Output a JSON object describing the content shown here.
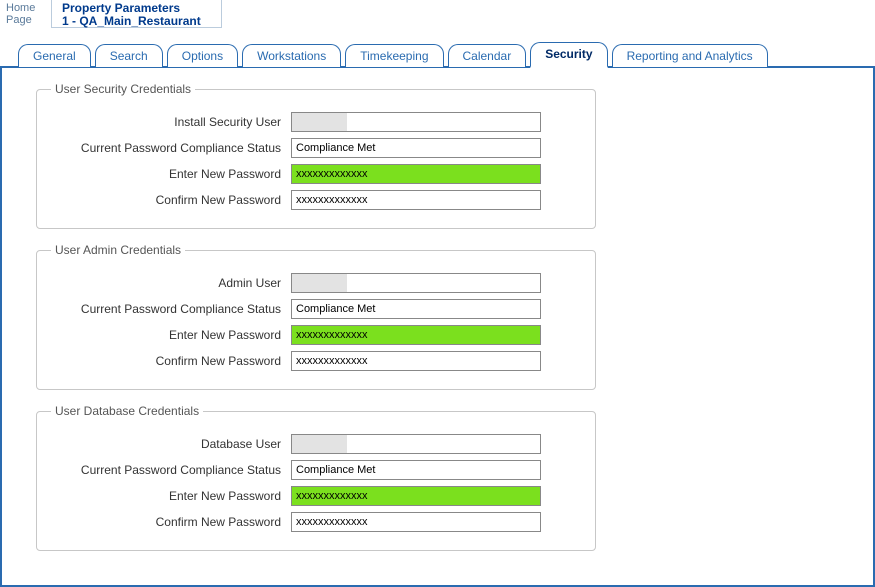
{
  "header": {
    "home_line1": "Home",
    "home_line2": "Page",
    "title_line1": "Property Parameters",
    "title_line2": "1 - QA_Main_Restaurant"
  },
  "tabs": [
    {
      "label": "General"
    },
    {
      "label": "Search"
    },
    {
      "label": "Options"
    },
    {
      "label": "Workstations"
    },
    {
      "label": "Timekeeping"
    },
    {
      "label": "Calendar"
    },
    {
      "label": "Security"
    },
    {
      "label": "Reporting and Analytics"
    }
  ],
  "active_tab": "Security",
  "sections": {
    "security": {
      "legend": "User Security Credentials",
      "install_user_label": "Install Security User",
      "install_user_value": "",
      "compliance_label": "Current Password Compliance Status",
      "compliance_value": "Compliance Met",
      "new_pw_label": "Enter New Password",
      "new_pw_value": "xxxxxxxxxxxxx",
      "confirm_pw_label": "Confirm New Password",
      "confirm_pw_value": "xxxxxxxxxxxxx"
    },
    "admin": {
      "legend": "User Admin Credentials",
      "user_label": "Admin User",
      "user_value": "",
      "compliance_label": "Current Password Compliance Status",
      "compliance_value": "Compliance Met",
      "new_pw_label": "Enter New Password",
      "new_pw_value": "xxxxxxxxxxxxx",
      "confirm_pw_label": "Confirm New Password",
      "confirm_pw_value": "xxxxxxxxxxxxx"
    },
    "database": {
      "legend": "User Database Credentials",
      "user_label": "Database User",
      "user_value": "",
      "compliance_label": "Current Password Compliance Status",
      "compliance_value": "Compliance Met",
      "new_pw_label": "Enter New  Password",
      "new_pw_value": "xxxxxxxxxxxxx",
      "confirm_pw_label": "Confirm New Password",
      "confirm_pw_value": "xxxxxxxxxxxxx"
    }
  }
}
